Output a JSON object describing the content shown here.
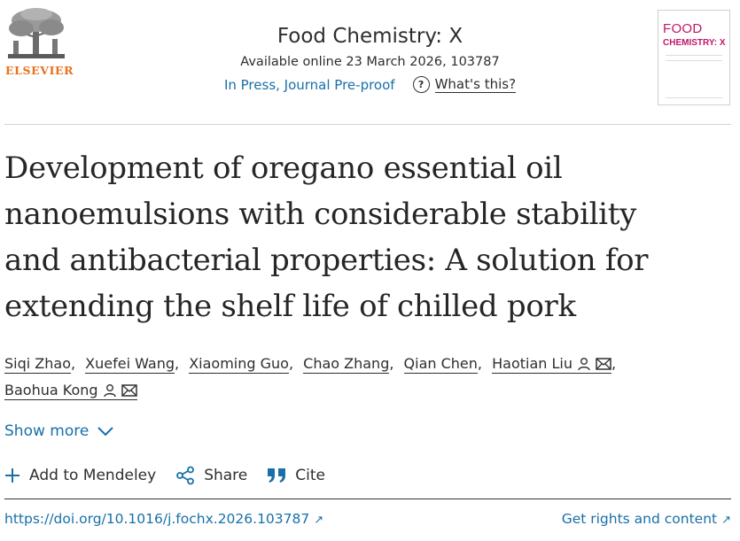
{
  "publisher": {
    "name": "ELSEVIER"
  },
  "journal": {
    "title": "Food Chemistry: X",
    "availability": "Available online 23 March 2026, 103787",
    "status": "In Press, Journal Pre-proof",
    "help_label": "What's this?",
    "help_glyph": "?",
    "cover_line1": "FOOD",
    "cover_line2": "CHEMISTRY: X"
  },
  "article": {
    "title_lines": [
      "Development of oregano essential oil",
      "nanoemulsions with considerable stability",
      "and antibacterial properties: A solution for",
      "extending the shelf life of chilled pork"
    ],
    "authors": [
      {
        "name": "Siqi Zhao",
        "sep": ","
      },
      {
        "name": "Xuefei Wang",
        "sep": ","
      },
      {
        "name": "Xiaoming Guo",
        "sep": ","
      },
      {
        "name": "Chao Zhang",
        "sep": ","
      },
      {
        "name": "Qian Chen",
        "sep": ","
      },
      {
        "name": "Haotian Liu",
        "sep": ","
      },
      {
        "name": "Baohua Kong",
        "sep": ""
      }
    ],
    "show_more": "Show more",
    "actions": {
      "mendeley": "Add to Mendeley",
      "share": "Share",
      "cite": "Cite"
    },
    "doi": "https://doi.org/10.1016/j.fochx.2026.103787",
    "rights": "Get rights and content",
    "arrow_glyph": "↗"
  },
  "colors": {
    "link": "#1870a8",
    "brand": "#e9711c",
    "cover_accent": "#c0186a"
  }
}
